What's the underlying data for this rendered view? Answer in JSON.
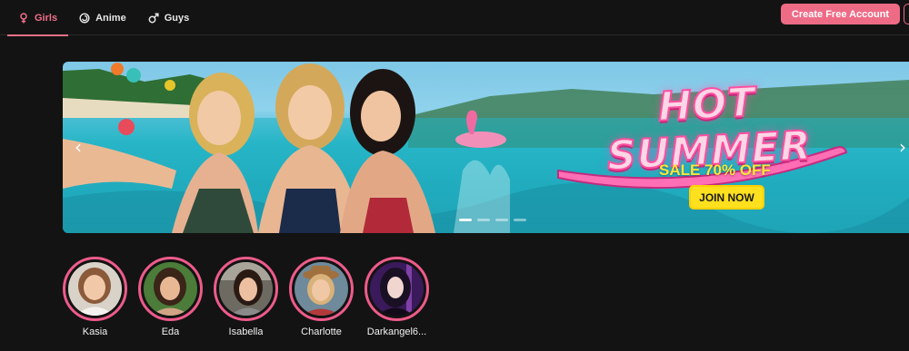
{
  "nav": {
    "tabs": [
      {
        "label": "Girls",
        "icon": "female-symbol-icon",
        "active": true
      },
      {
        "label": "Anime",
        "icon": "spiral-icon",
        "active": false
      },
      {
        "label": "Guys",
        "icon": "male-symbol-icon",
        "active": false
      }
    ],
    "cta_label": "Create Free Account"
  },
  "banner": {
    "title": "HOT SUMMER",
    "subtitle": "SALE 70% OFF",
    "button_label": "JOIN NOW",
    "prev_icon": "chevron-left-icon",
    "next_icon": "chevron-right-icon",
    "slides": 4,
    "active_slide": 1
  },
  "stories": [
    {
      "name": "Kasia",
      "hair": "#8a5a3a",
      "bg": "#d9d2c8"
    },
    {
      "name": "Eda",
      "hair": "#3b2418",
      "bg": "#4b7c3a"
    },
    {
      "name": "Isabella",
      "hair": "#2a1a14",
      "bg": "#6d6a62"
    },
    {
      "name": "Charlotte",
      "hair": "#d9b17a",
      "bg": "#6f8a9a"
    },
    {
      "name": "Darkangel6...",
      "hair": "#1a1024",
      "bg": "#3a1a5a"
    }
  ],
  "colors": {
    "accent": "#ee6b86",
    "background": "#131313",
    "promo_yellow": "#ffe01f",
    "ring": "#ee5b8a"
  }
}
